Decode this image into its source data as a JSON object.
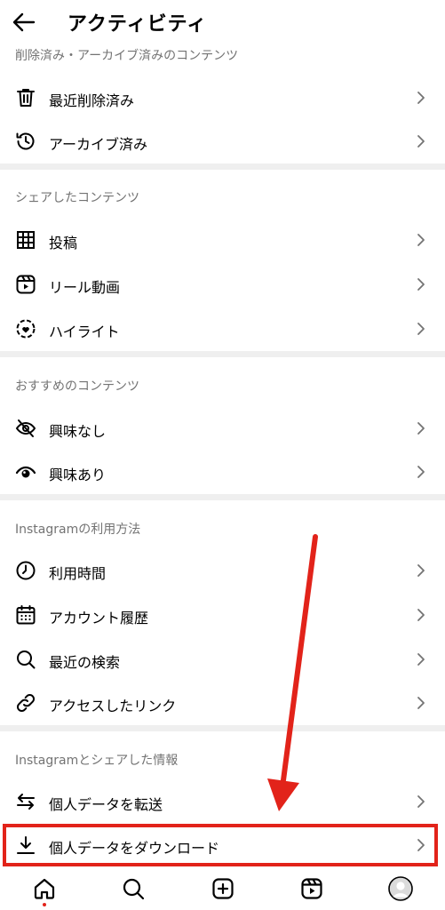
{
  "header": {
    "title": "アクティビティ",
    "back_icon": "arrow-left-icon"
  },
  "sections": [
    {
      "title": "削除済み・アーカイブ済みのコンテンツ",
      "items": [
        {
          "label": "最近削除済み",
          "icon": "trash-icon"
        },
        {
          "label": "アーカイブ済み",
          "icon": "archive-history-icon"
        }
      ]
    },
    {
      "title": "シェアしたコンテンツ",
      "items": [
        {
          "label": "投稿",
          "icon": "grid-icon"
        },
        {
          "label": "リール動画",
          "icon": "reels-icon"
        },
        {
          "label": "ハイライト",
          "icon": "highlight-icon"
        }
      ]
    },
    {
      "title": "おすすめのコンテンツ",
      "items": [
        {
          "label": "興味なし",
          "icon": "eye-off-icon"
        },
        {
          "label": "興味あり",
          "icon": "eye-icon"
        }
      ]
    },
    {
      "title": "Instagramの利用方法",
      "items": [
        {
          "label": "利用時間",
          "icon": "clock-icon"
        },
        {
          "label": "アカウント履歴",
          "icon": "calendar-icon"
        },
        {
          "label": "最近の検索",
          "icon": "search-icon"
        },
        {
          "label": "アクセスしたリンク",
          "icon": "link-icon"
        }
      ]
    },
    {
      "title": "Instagramとシェアした情報",
      "items": [
        {
          "label": "個人データを転送",
          "icon": "transfer-icon"
        },
        {
          "label": "個人データをダウンロード",
          "icon": "download-icon"
        }
      ]
    }
  ],
  "bottom_nav": [
    {
      "name": "home-icon",
      "active": true
    },
    {
      "name": "search-icon"
    },
    {
      "name": "create-icon"
    },
    {
      "name": "reels-icon"
    },
    {
      "name": "profile-avatar"
    }
  ],
  "colors": {
    "text": "#000000",
    "section_title": "#737373",
    "divider": "#efefef",
    "annotation_red": "#e2231a",
    "notification_dot": "#e2231a"
  }
}
